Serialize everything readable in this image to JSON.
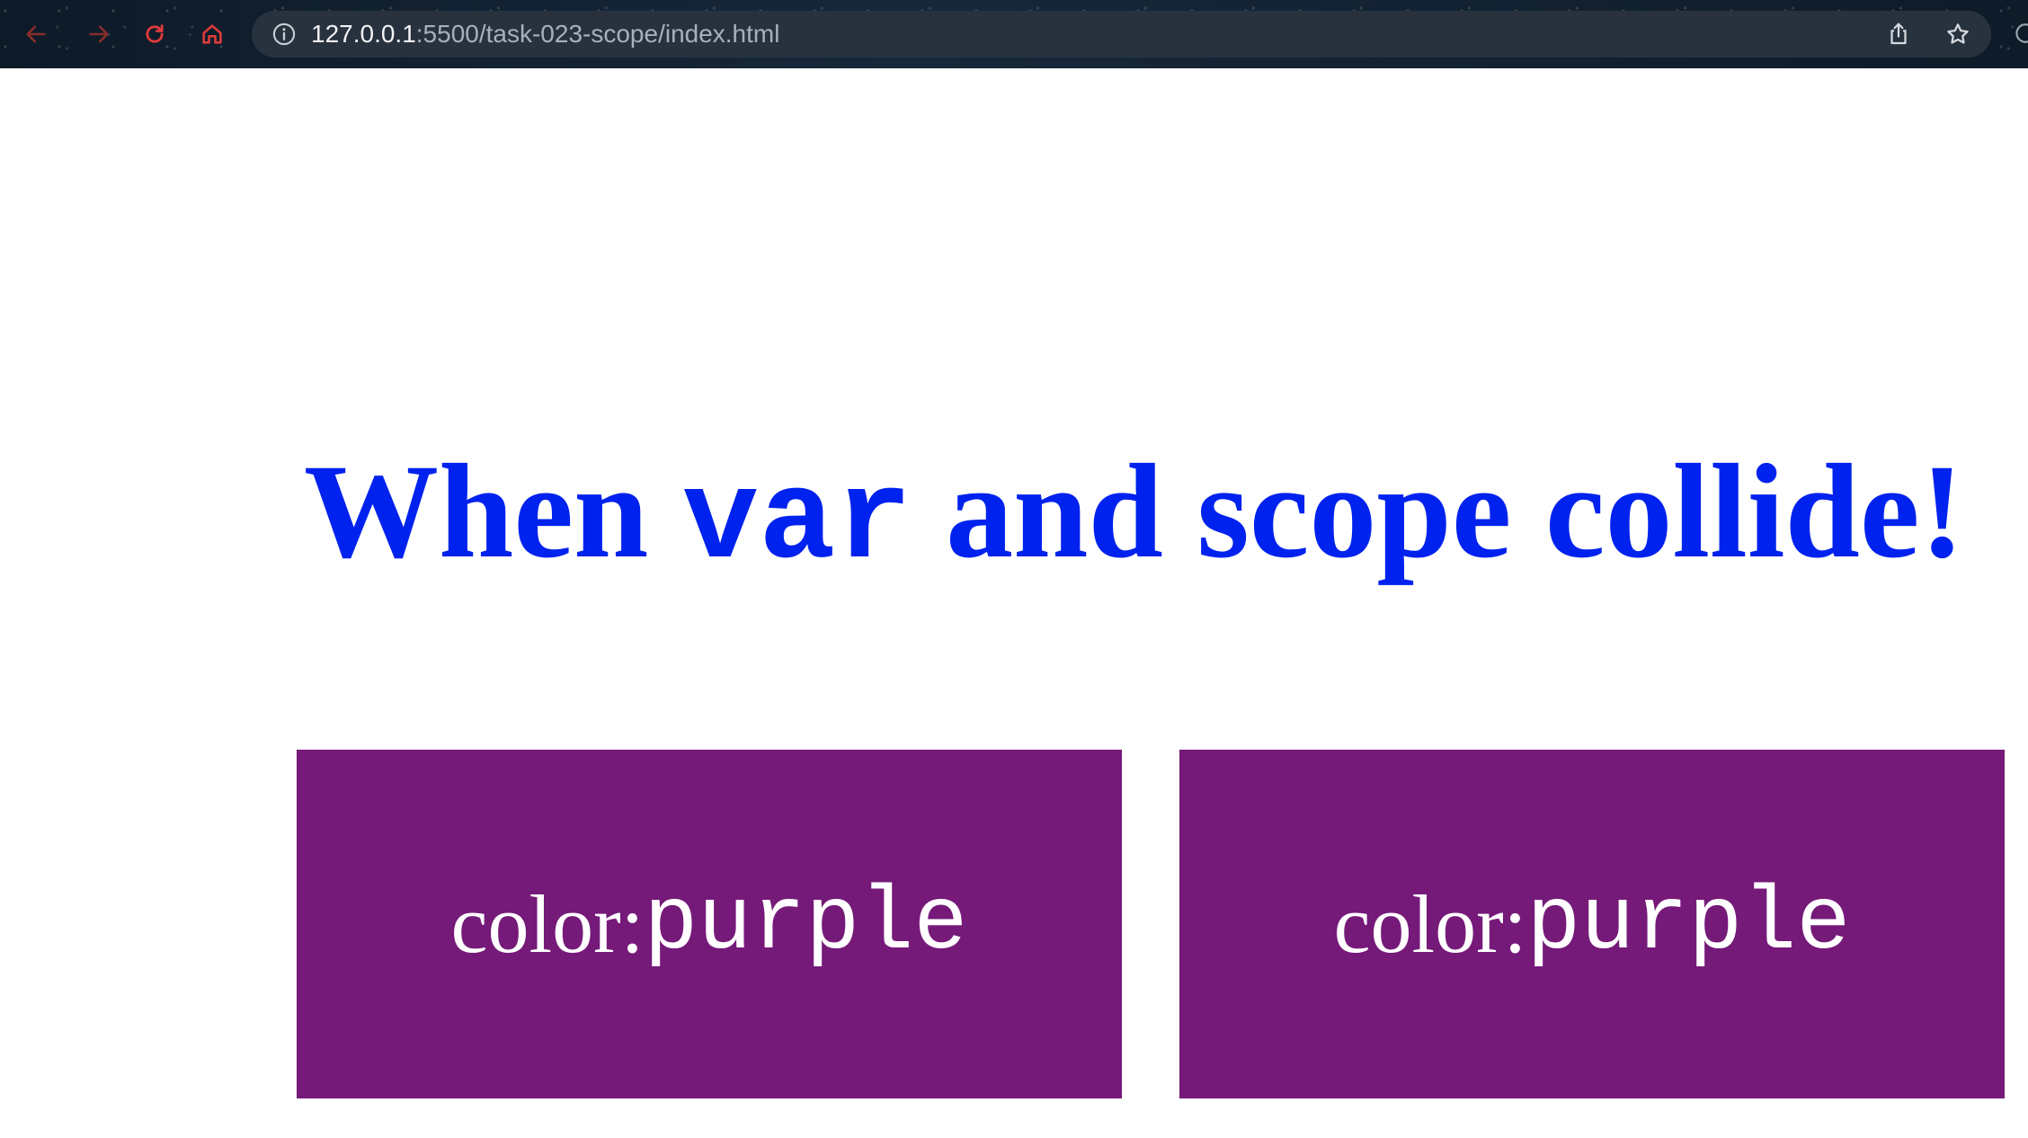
{
  "browser": {
    "url_host": "127.0.0.1",
    "url_path": ":5500/task-023-scope/index.html",
    "icons": {
      "back": "back-arrow-icon",
      "forward": "forward-arrow-icon",
      "reload": "reload-icon",
      "home": "home-icon",
      "info": "info-icon",
      "share": "share-icon",
      "bookmark": "star-icon"
    },
    "nav_icon_color": "#e03a3a"
  },
  "page": {
    "headline": {
      "before": "When ",
      "code": "var",
      "after": " and scope collide!",
      "color": "#0022ee"
    },
    "boxes": [
      {
        "label": "color: ",
        "value": "purple",
        "background": "#751a79"
      },
      {
        "label": "color: ",
        "value": "purple",
        "background": "#751a79"
      }
    ]
  }
}
